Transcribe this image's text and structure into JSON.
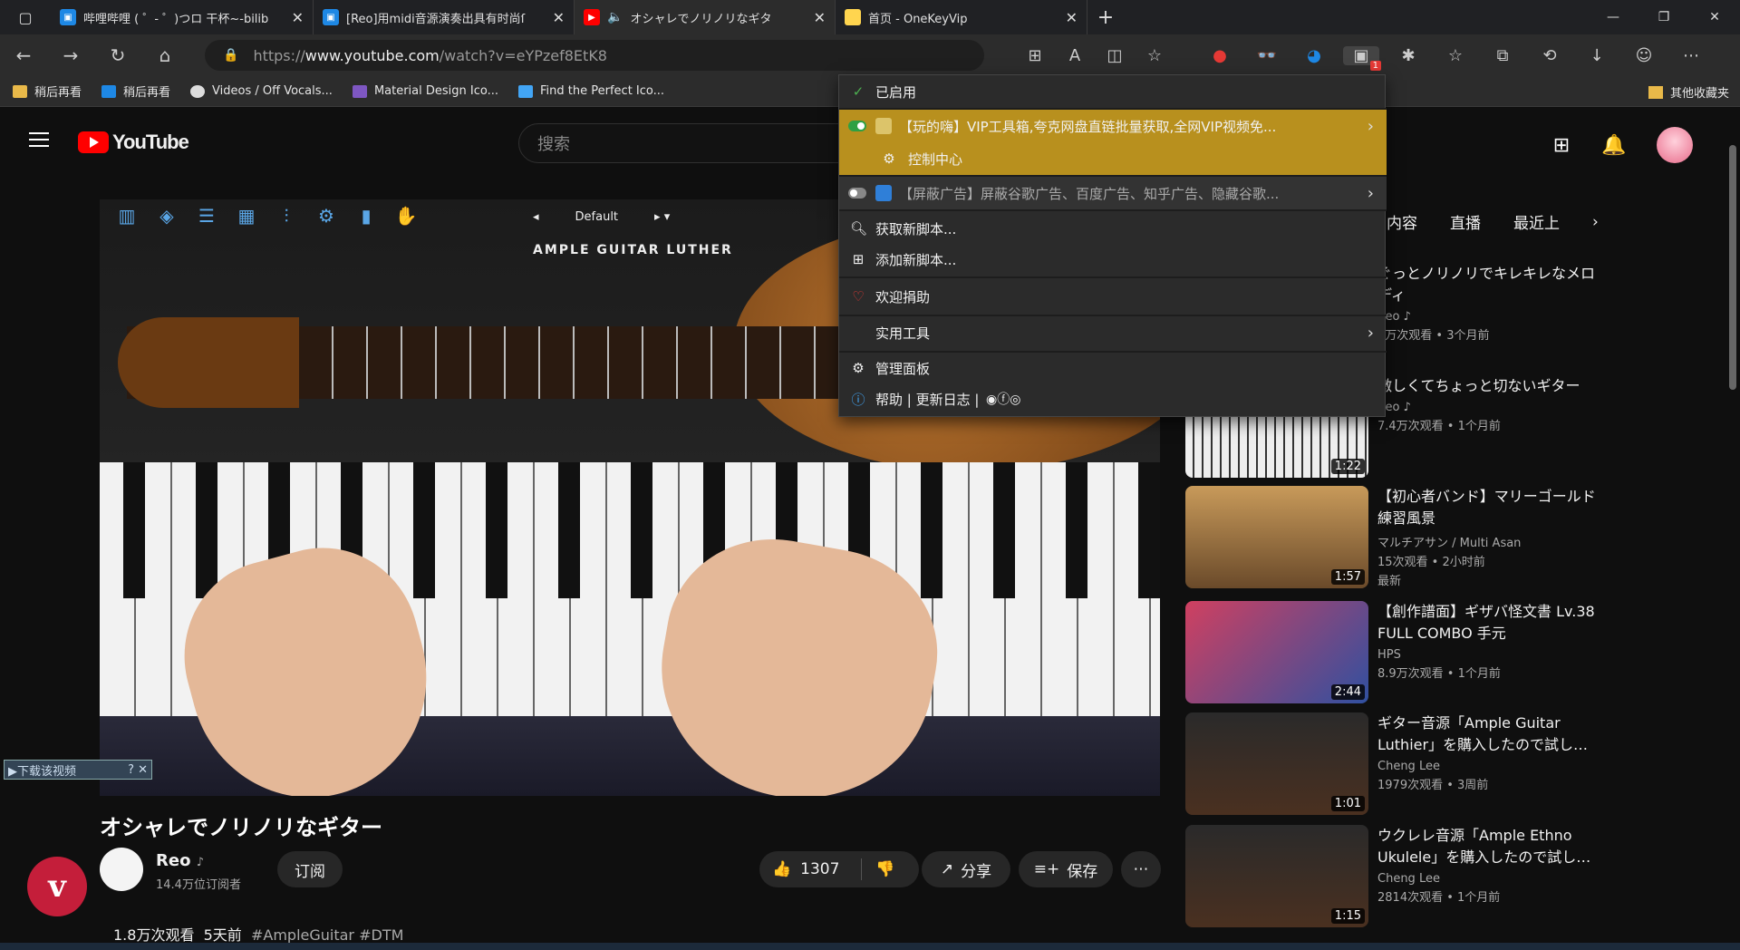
{
  "browser": {
    "tabs": [
      {
        "title": "哔哩哔哩 ( ゜- ゜)つロ 干杯~-bilib",
        "fav_color": "#1e88e5"
      },
      {
        "title": "[Reo]用midi音源演奏出具有时尚ſ",
        "fav_color": "#1e88e5"
      },
      {
        "title": "オシャレでノリノリなギタ",
        "fav_color": "#ff0000",
        "active": true
      },
      {
        "title": "首页 - OneKeyVip",
        "fav_color": "#ffd54f"
      }
    ],
    "url_prefix": "https://",
    "url_host": "www.youtube.com",
    "url_path": "/watch?v=eYPzef8EtK8",
    "bookmarks": [
      {
        "label": "稍后再看",
        "color": "#e9b949"
      },
      {
        "label": "稍后再看",
        "color": "#1e88e5"
      },
      {
        "label": "Videos / Off Vocals...",
        "color": "#dddddd"
      },
      {
        "label": "Material Design Ico...",
        "color": "#7e57c2"
      },
      {
        "label": "Find the Perfect Ico...",
        "color": "#42a5f5"
      }
    ],
    "other_bookmarks": "其他收藏夹",
    "ext_badge": "1"
  },
  "youtube": {
    "logo": "YouTube",
    "search_placeholder": "搜索",
    "video": {
      "plugin_preset": "Default",
      "plugin_title": "AMPLE GUITAR LUTHER",
      "download_badge": "▶下载该视频",
      "title": "オシャレでノリノリなギター",
      "channel": "Reo",
      "channel_note": "♪",
      "subscribers": "14.4万位订阅者",
      "subscribe": "订阅",
      "likes": "1307",
      "share": "分享",
      "save": "保存",
      "views": "1.8万次观看",
      "age": "5天前",
      "tags": "#AmpleGuitar #DTM"
    },
    "chips": [
      "内容",
      "直播",
      "最近上"
    ],
    "recommendations": [
      {
        "title": "ぐっとノリノリでキレキレなメロディ",
        "channel": "Reo ♪",
        "views": "5万次观看 • 3个月前",
        "duration": "",
        "thumb": "#333333"
      },
      {
        "title": "激しくてちょっと切ないギター",
        "channel": "Reo ♪",
        "views": "7.4万次观看 • 1个月前",
        "duration": "1:22",
        "thumb": "#dddddd"
      },
      {
        "title": "【初心者バンド】マリーゴールド 練習風景",
        "channel": "マルチアサン / Multi Asan",
        "views": "15次观看 • 2小时前",
        "extra": "最新",
        "duration": "1:57",
        "thumb": "#8a6a3a"
      },
      {
        "title": "【創作譜面】ギザバ怪文書 Lv.38 FULL COMBO 手元",
        "channel": "HPS",
        "views": "8.9万次观看 • 1个月前",
        "duration": "2:44",
        "thumb": "#b03050"
      },
      {
        "title": "ギター音源「Ample Guitar Luthier」を購入したので試し…",
        "channel": "Cheng Lee",
        "views": "1979次观看 • 3周前",
        "duration": "1:01",
        "thumb": "#2a2a2a"
      },
      {
        "title": "ウクレレ音源「Ample Ethno Ukulele」を購入したので試し…",
        "channel": "Cheng Lee",
        "views": "2814次观看 • 1个月前",
        "duration": "1:15",
        "thumb": "#2a2a2a"
      }
    ]
  },
  "menu": {
    "enabled": "已启用",
    "script1": "【玩的嗨】VIP工具箱,夸克网盘直链批量获取,全网VIP视频免...",
    "control_center": "控制中心",
    "script2": "【屏蔽广告】屏蔽谷歌广告、百度广告、知乎广告、隐藏谷歌...",
    "get_scripts": "获取新脚本...",
    "add_script": "添加新脚本...",
    "donate": "欢迎捐助",
    "tools": "实用工具",
    "dashboard": "管理面板",
    "help": "帮助 | 更新日志 |"
  },
  "colors": {
    "menu_highlight": "#b8901e",
    "youtube_red": "#ff0000"
  }
}
